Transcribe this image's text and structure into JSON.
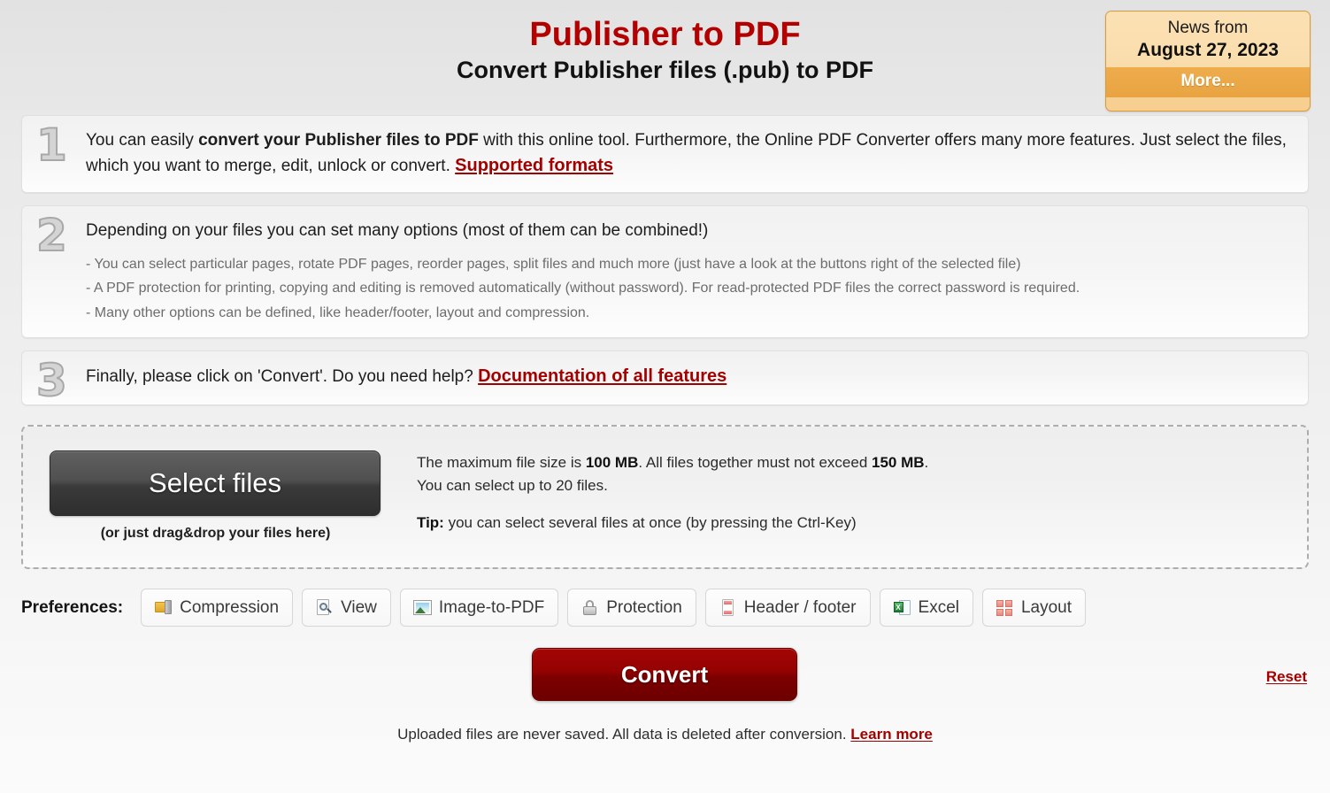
{
  "header": {
    "title": "Publisher to PDF",
    "subtitle": "Convert Publisher files (.pub) to PDF",
    "accent_red": "#b30000"
  },
  "news": {
    "label": "News from",
    "date": "August 27, 2023",
    "more_label": "More...",
    "accent_orange": "#e9a441"
  },
  "steps": [
    {
      "number": "1",
      "text_before": "You can easily ",
      "text_bold": "convert your Publisher files to PDF",
      "text_after": " with this online tool. Furthermore, the Online PDF Converter offers many more features. Just select the files, which you want to merge, edit, unlock or convert. ",
      "link": "Supported formats"
    },
    {
      "number": "2",
      "text": "Depending on your files you can set many options (most of them can be combined!)",
      "bullets": [
        "- You can select particular pages, rotate PDF pages, reorder pages, split files and much more (just have a look at the buttons right of the selected file)",
        "- A PDF protection for printing, copying and editing is removed automatically (without password). For read-protected PDF files the correct password is required.",
        "- Many other options can be defined, like header/footer, layout and compression."
      ]
    },
    {
      "number": "3",
      "text": "Finally, please click on 'Convert'. Do you need help? ",
      "link": "Documentation of all features"
    }
  ],
  "dropzone": {
    "select_button": "Select files",
    "hint": "(or just drag&drop your files here)",
    "info_line1_a": "The maximum file size is ",
    "info_line1_b": "100 MB",
    "info_line1_c": ". All files together must not exceed ",
    "info_line1_d": "150 MB",
    "info_line1_e": ".",
    "info_line2": "You can select up to 20 files.",
    "tip_label": "Tip:",
    "tip_text": " you can select several files at once (by pressing the Ctrl-Key)"
  },
  "preferences": {
    "label": "Preferences:",
    "items": [
      {
        "label": "Compression",
        "icon": "compression-icon"
      },
      {
        "label": "View",
        "icon": "view-icon"
      },
      {
        "label": "Image-to-PDF",
        "icon": "image-icon"
      },
      {
        "label": "Protection",
        "icon": "lock-icon"
      },
      {
        "label": "Header / footer",
        "icon": "header-footer-icon"
      },
      {
        "label": "Excel",
        "icon": "excel-icon"
      },
      {
        "label": "Layout",
        "icon": "layout-icon"
      }
    ]
  },
  "actions": {
    "convert_label": "Convert",
    "reset_label": "Reset"
  },
  "footer": {
    "text": "Uploaded files are never saved. All data is deleted after conversion. ",
    "link": "Learn more"
  },
  "icons": {
    "excel_badge": "X"
  }
}
